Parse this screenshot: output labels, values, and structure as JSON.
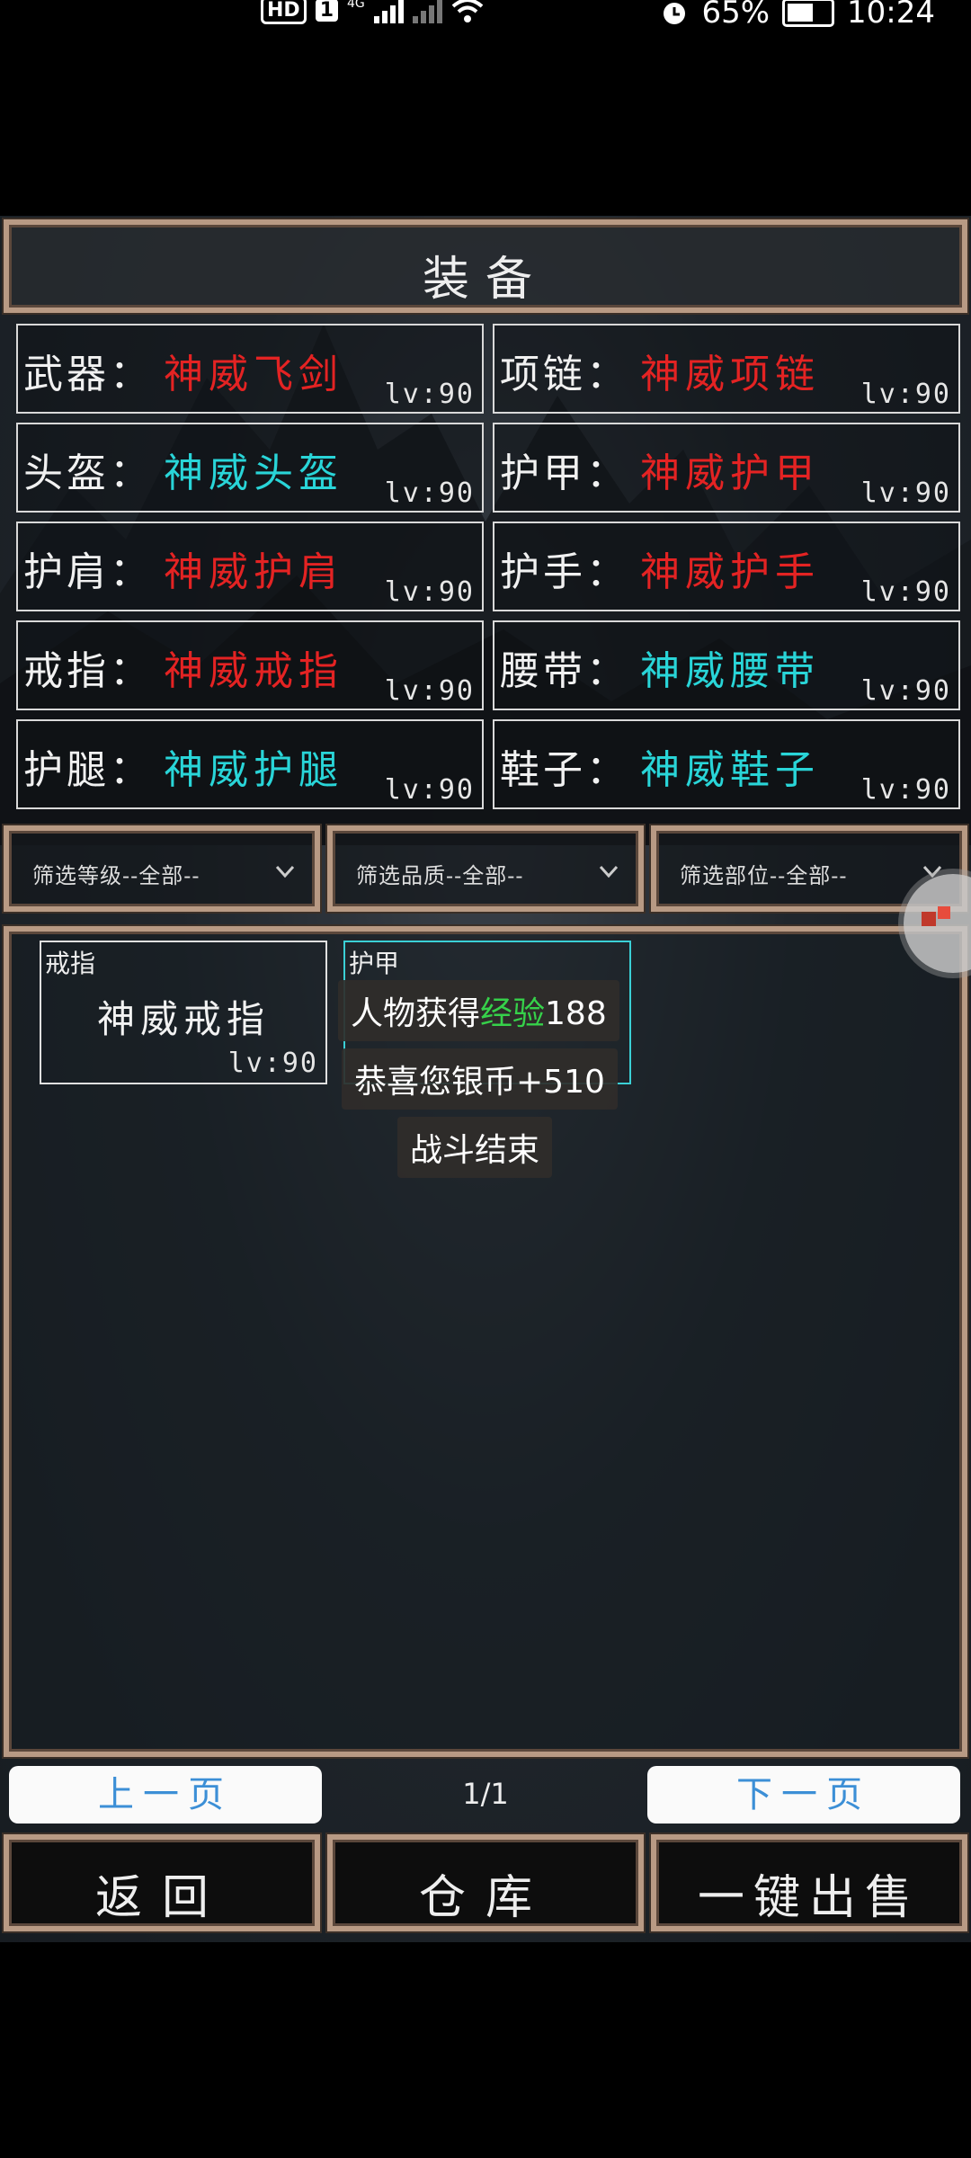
{
  "status_bar": {
    "hd": "HD",
    "sim": "1",
    "network": "4G",
    "battery": "65%",
    "time": "10:24"
  },
  "header": {
    "title": "装备"
  },
  "equipment": [
    {
      "label": "武器：",
      "item": "神威飞剑",
      "level": "lv:90",
      "color": "#e42323"
    },
    {
      "label": "项链：",
      "item": "神威项链",
      "level": "lv:90",
      "color": "#e42323"
    },
    {
      "label": "头盔：",
      "item": "神威头盔",
      "level": "lv:90",
      "color": "#29d5d8"
    },
    {
      "label": "护甲：",
      "item": "神威护甲",
      "level": "lv:90",
      "color": "#e42323"
    },
    {
      "label": "护肩：",
      "item": "神威护肩",
      "level": "lv:90",
      "color": "#e42323"
    },
    {
      "label": "护手：",
      "item": "神威护手",
      "level": "lv:90",
      "color": "#e42323"
    },
    {
      "label": "戒指：",
      "item": "神威戒指",
      "level": "lv:90",
      "color": "#e42323"
    },
    {
      "label": "腰带：",
      "item": "神威腰带",
      "level": "lv:90",
      "color": "#29d5d8"
    },
    {
      "label": "护腿：",
      "item": "神威护腿",
      "level": "lv:90",
      "color": "#29d5d8"
    },
    {
      "label": "鞋子：",
      "item": "神威鞋子",
      "level": "lv:90",
      "color": "#29d5d8"
    }
  ],
  "filters": {
    "level": "筛选等级--全部--",
    "quality": "筛选品质--全部--",
    "slot": "筛选部位--全部--"
  },
  "inventory": [
    {
      "type": "戒指",
      "name": "神威戒指",
      "level": "lv:90"
    },
    {
      "type": "护甲",
      "name": "",
      "level": ""
    }
  ],
  "toasts": {
    "exp_prefix": "人物获得",
    "exp_word": "经验",
    "exp_value": "188",
    "silver": "恭喜您银币+510",
    "battle_end": "战斗结束"
  },
  "pager": {
    "prev": "上一页",
    "page": "1/1",
    "next": "下一页"
  },
  "actions": {
    "back": "返回",
    "warehouse": "仓库",
    "sell_all": "一键出售"
  },
  "colors": {
    "red_item": "#e42323",
    "cyan_item": "#29d5d8",
    "frame": "#b89a84",
    "exp_green": "#36d14a",
    "pager_text": "#3c8fd6"
  }
}
